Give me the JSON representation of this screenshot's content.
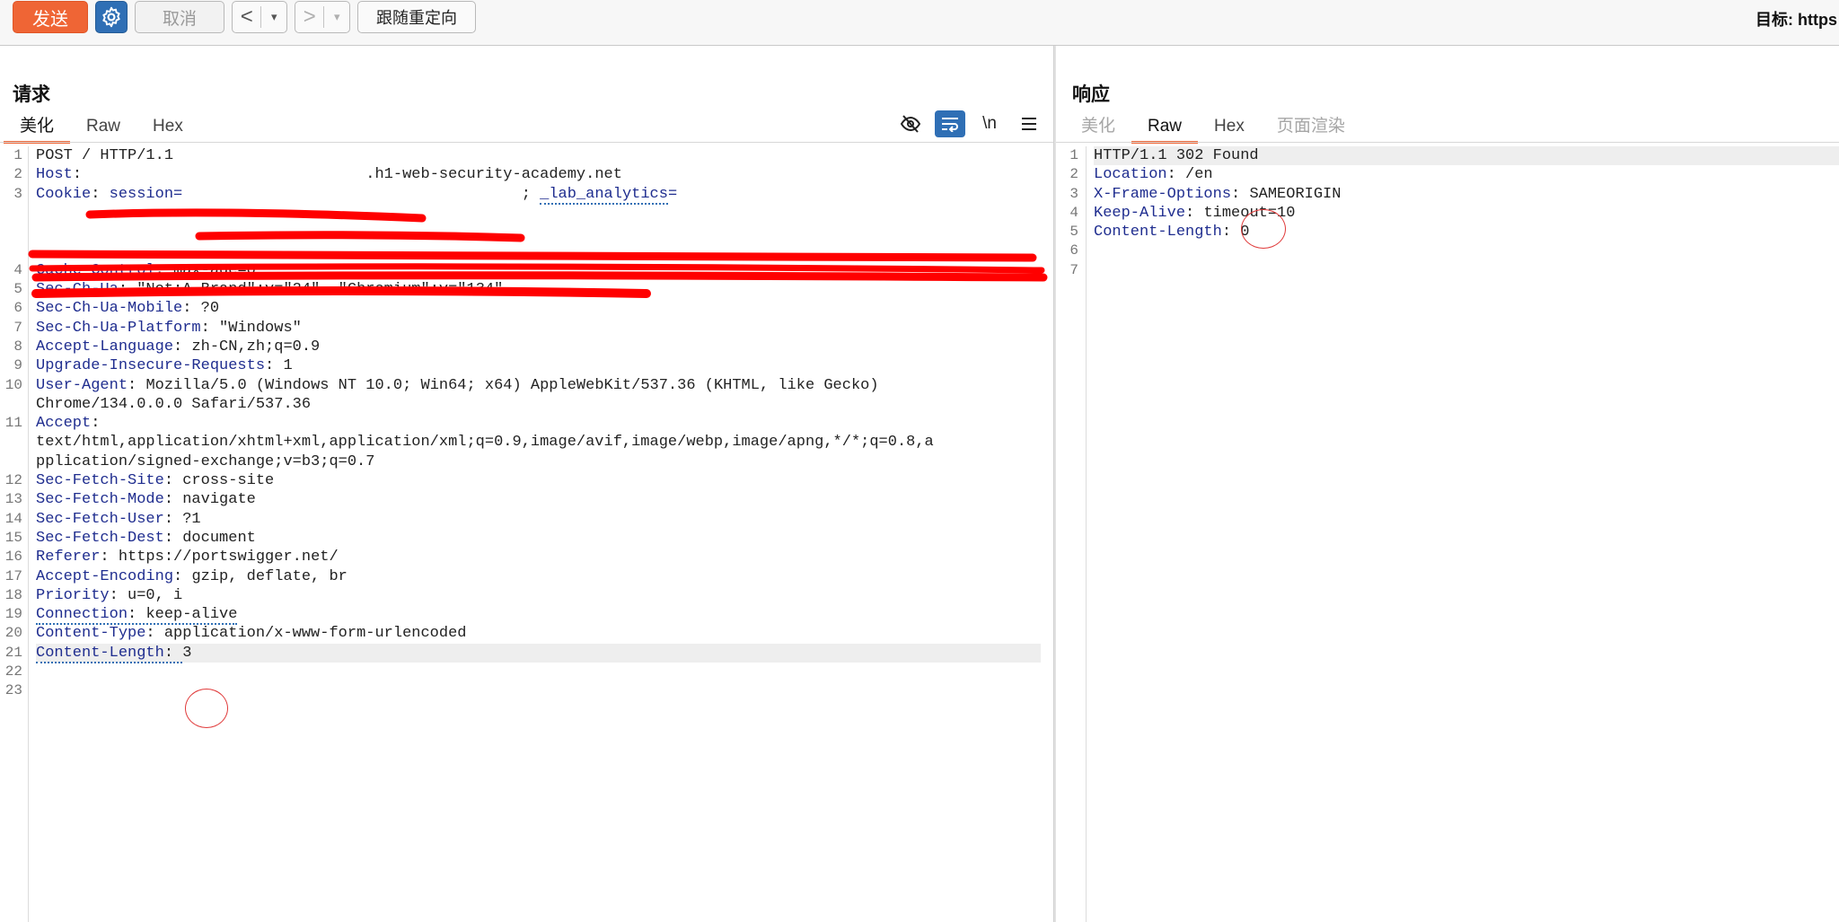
{
  "toolbar": {
    "send_label": "发送",
    "settings_icon": "gear-icon",
    "cancel_label": "取消",
    "back_arrow": "<",
    "forward_arrow": ">",
    "dropdown_glyph": "▾",
    "follow_redirect_label": "跟随重定向",
    "target_label": "目标: https"
  },
  "request": {
    "title": "请求",
    "tabs": [
      {
        "label": "美化",
        "active": true
      },
      {
        "label": "Raw",
        "active": false
      },
      {
        "label": "Hex",
        "active": false
      }
    ],
    "tools": {
      "hide_icon": "eye-off-icon",
      "wrap_icon": "wrap-lines-icon",
      "newline_label": "\\n",
      "menu_icon": "hamburger-menu-icon"
    },
    "lines": [
      {
        "n": "1",
        "name": "",
        "sep": "",
        "value": "POST / HTTP/1.1"
      },
      {
        "n": "2",
        "name": "Host",
        "sep": ": ",
        "value": ".h1-web-security-academy.net"
      },
      {
        "n": "3",
        "name": "Cookie",
        "sep": ": ",
        "value": "session=",
        "extra_name": "_lab_analytics",
        "extra_value": "="
      },
      {
        "n": "4",
        "name": "Cache-Control",
        "sep": ": ",
        "value": "max-age=0"
      },
      {
        "n": "5",
        "name": "Sec-Ch-Ua",
        "sep": ": ",
        "value": "\"Not:A-Brand\";v=\"24\", \"Chromium\";v=\"134\""
      },
      {
        "n": "6",
        "name": "Sec-Ch-Ua-Mobile",
        "sep": ": ",
        "value": "?0"
      },
      {
        "n": "7",
        "name": "Sec-Ch-Ua-Platform",
        "sep": ": ",
        "value": "\"Windows\""
      },
      {
        "n": "8",
        "name": "Accept-Language",
        "sep": ": ",
        "value": "zh-CN,zh;q=0.9"
      },
      {
        "n": "9",
        "name": "Upgrade-Insecure-Requests",
        "sep": ": ",
        "value": "1"
      },
      {
        "n": "10",
        "name": "User-Agent",
        "sep": ": ",
        "value": "Mozilla/5.0 (Windows NT 10.0; Win64; x64) AppleWebKit/537.36 (KHTML, like Gecko)",
        "cont": [
          "Chrome/134.0.0.0 Safari/537.36"
        ]
      },
      {
        "n": "11",
        "name": "Accept",
        "sep": ":",
        "value": "",
        "cont": [
          "text/html,application/xhtml+xml,application/xml;q=0.9,image/avif,image/webp,image/apng,*/*;q=0.8,a",
          "pplication/signed-exchange;v=b3;q=0.7"
        ]
      },
      {
        "n": "12",
        "name": "Sec-Fetch-Site",
        "sep": ": ",
        "value": "cross-site"
      },
      {
        "n": "13",
        "name": "Sec-Fetch-Mode",
        "sep": ": ",
        "value": "navigate"
      },
      {
        "n": "14",
        "name": "Sec-Fetch-User",
        "sep": ": ",
        "value": "?1"
      },
      {
        "n": "15",
        "name": "Sec-Fetch-Dest",
        "sep": ": ",
        "value": "document"
      },
      {
        "n": "16",
        "name": "Referer",
        "sep": ": ",
        "value": "https://portswigger.net/"
      },
      {
        "n": "17",
        "name": "Accept-Encoding",
        "sep": ": ",
        "value": "gzip, deflate, br"
      },
      {
        "n": "18",
        "name": "Priority",
        "sep": ": ",
        "value": "u=0, i"
      },
      {
        "n": "19",
        "name": "Connection",
        "sep": ": ",
        "value": "keep-alive"
      },
      {
        "n": "20",
        "name": "Content-Type",
        "sep": ": ",
        "value": "application/x-www-form-urlencoded"
      },
      {
        "n": "21",
        "name": "Content-Length",
        "sep": ": ",
        "value": "3"
      },
      {
        "n": "22",
        "name": "",
        "sep": "",
        "value": ""
      },
      {
        "n": "23",
        "name": "",
        "sep": "",
        "value": ""
      }
    ]
  },
  "response": {
    "title": "响应",
    "tabs": [
      {
        "label": "美化",
        "state": "disabled"
      },
      {
        "label": "Raw",
        "state": "active"
      },
      {
        "label": "Hex",
        "state": "normal"
      },
      {
        "label": "页面渲染",
        "state": "disabled"
      }
    ],
    "lines": [
      {
        "n": "1",
        "name": "",
        "sep": "",
        "value": "HTTP/1.1 302 Found"
      },
      {
        "n": "2",
        "name": "Location",
        "sep": ": ",
        "value": "/en"
      },
      {
        "n": "3",
        "name": "X-Frame-Options",
        "sep": ": ",
        "value": "SAMEORIGIN"
      },
      {
        "n": "4",
        "name": "Keep-Alive",
        "sep": ": ",
        "value": "timeout=10"
      },
      {
        "n": "5",
        "name": "Content-Length",
        "sep": ": ",
        "value": "0"
      },
      {
        "n": "6",
        "name": "",
        "sep": "",
        "value": ""
      },
      {
        "n": "7",
        "name": "",
        "sep": "",
        "value": ""
      }
    ]
  },
  "colors": {
    "accent": "#ef6535",
    "header_name": "#1f2d8f",
    "gear_bg": "#2f6fb5",
    "redaction": "#ff0000"
  }
}
